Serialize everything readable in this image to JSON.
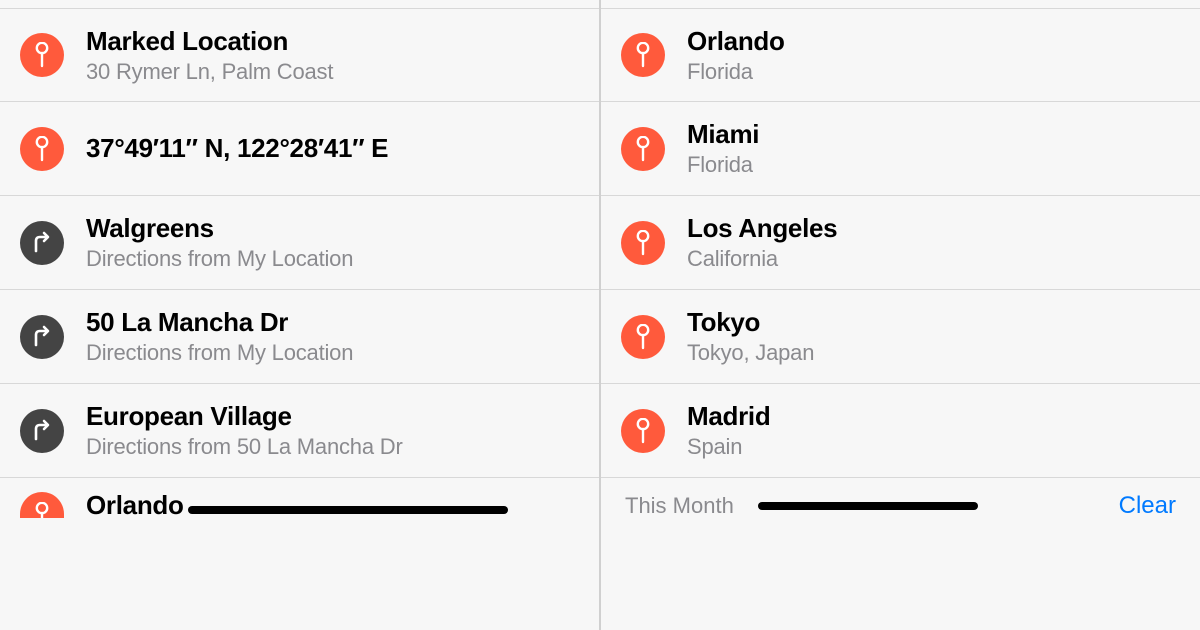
{
  "left": {
    "items": [
      {
        "icon": "pin",
        "title": "Marked Location",
        "subtitle": "30 Rymer Ln, Palm Coast"
      },
      {
        "icon": "pin",
        "title": "37°49′11″ N, 122°28′41″ E",
        "subtitle": ""
      },
      {
        "icon": "turn",
        "title": "Walgreens",
        "subtitle": "Directions from My Location"
      },
      {
        "icon": "turn",
        "title": "50 La Mancha Dr",
        "subtitle": "Directions from My Location"
      },
      {
        "icon": "turn",
        "title": "European Village",
        "subtitle": "Directions from 50 La Mancha Dr"
      }
    ],
    "partial": {
      "icon": "pin",
      "title": "Orlando"
    }
  },
  "right": {
    "items": [
      {
        "icon": "pin",
        "title": "Orlando",
        "subtitle": "Florida"
      },
      {
        "icon": "pin",
        "title": "Miami",
        "subtitle": "Florida"
      },
      {
        "icon": "pin",
        "title": "Los Angeles",
        "subtitle": "California"
      },
      {
        "icon": "pin",
        "title": "Tokyo",
        "subtitle": "Tokyo, Japan"
      },
      {
        "icon": "pin",
        "title": "Madrid",
        "subtitle": "Spain"
      }
    ],
    "section_label": "This Month",
    "clear_label": "Clear"
  }
}
